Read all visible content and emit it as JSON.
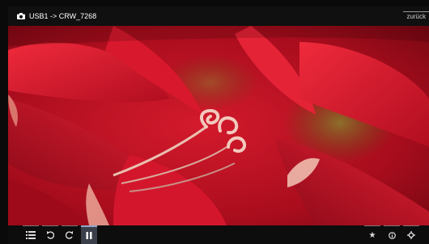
{
  "header": {
    "camera_icon": "camera-icon",
    "path": "USB1 -> CRW_7268",
    "back_label": "zurück"
  },
  "photo": {
    "subject": "red-flower-photo"
  },
  "toolbar": {
    "left": [
      {
        "name": "list-view-button",
        "icon": "list-icon"
      },
      {
        "name": "rotate-left-button",
        "icon": "rotate-left-icon"
      },
      {
        "name": "rotate-right-button",
        "icon": "rotate-right-icon"
      },
      {
        "name": "pause-button",
        "icon": "pause-icon",
        "active": true
      }
    ],
    "right": [
      {
        "name": "favorite-button",
        "icon": "star-icon"
      },
      {
        "name": "info-button",
        "icon": "info-icon"
      },
      {
        "name": "settings-button",
        "icon": "gear-icon"
      }
    ]
  },
  "colors": {
    "background": "#0a0a0a",
    "bar": "#0d0d0d",
    "active_button": "#3a3f4a",
    "flower_red": "#c8102a"
  }
}
